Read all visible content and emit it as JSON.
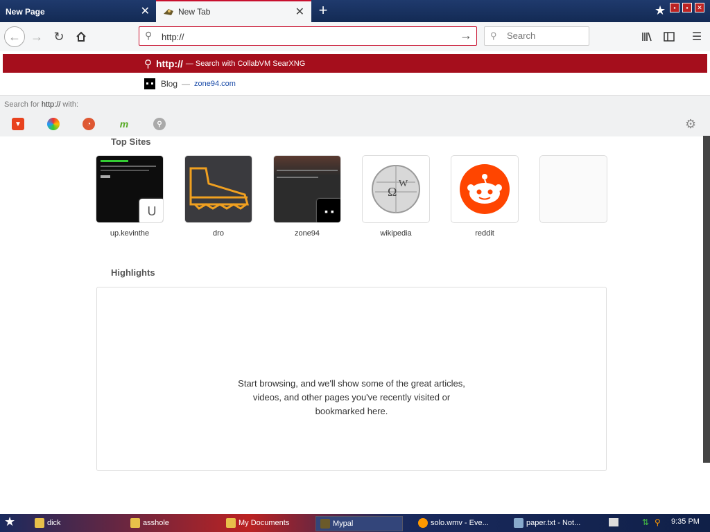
{
  "tabs": [
    {
      "title": "New Page",
      "active": false
    },
    {
      "title": "New Tab",
      "active": true
    }
  ],
  "navbar": {
    "url_value": "http://",
    "search_placeholder": "Search"
  },
  "dropdown": {
    "suggestion_query": "http://",
    "suggestion_action": "— Search with CollabVM SearXNG",
    "bookmark_title": "Blog",
    "bookmark_sep": "—",
    "bookmark_url": "zone94.com",
    "oneoff_prefix": "Search for ",
    "oneoff_query": "http://",
    "oneoff_suffix": " with:",
    "engines": [
      "brave-icon",
      "qwant-icon",
      "duckduckgo-icon",
      "mojeek-icon",
      "searx-icon"
    ]
  },
  "newtab": {
    "top_sites_title": "Top Sites",
    "sites": [
      {
        "label": "up.kevinthe",
        "badge": "U"
      },
      {
        "label": "dro"
      },
      {
        "label": "zone94"
      },
      {
        "label": "wikipedia"
      },
      {
        "label": "reddit"
      },
      {
        "label": ""
      }
    ],
    "highlights_title": "Highlights",
    "highlights_line1": "Start browsing, and we'll show some of the great articles,",
    "highlights_line2": "videos, and other pages you've recently visited or",
    "highlights_line3": "bookmarked here."
  },
  "taskbar": {
    "items": [
      "dick",
      "asshole",
      "My Documents",
      "Mypal",
      "solo.wmv - Eve...",
      "paper.txt - Not..."
    ],
    "clock": "9:35 PM"
  },
  "colors": {
    "accent": "#c8102e",
    "suggestion_bg": "#a50e1c",
    "reddit": "#ff4500"
  }
}
